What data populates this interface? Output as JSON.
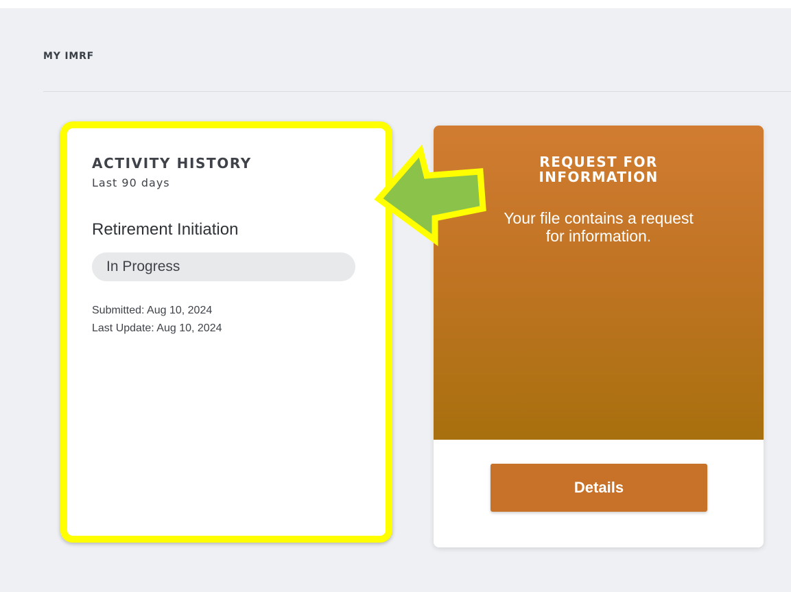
{
  "section": {
    "title": "MY IMRF"
  },
  "activity": {
    "title": "ACTIVITY HISTORY",
    "subtitle": "Last 90 days",
    "item_name": "Retirement Initiation",
    "status": "In Progress",
    "submitted": "Submitted: Aug 10, 2024",
    "last_update": "Last Update: Aug 10, 2024"
  },
  "request": {
    "title_line1": "REQUEST FOR",
    "title_line2": "INFORMATION",
    "text_line1": "Your file contains a request",
    "text_line2": "for information.",
    "button_label": "Details"
  },
  "colors": {
    "highlight": "#ffff00",
    "arrow_fill": "#8bc34a",
    "card_orange": "#c17424",
    "button_orange": "#c77129"
  },
  "icons": {
    "annotation": "arrow-left-icon"
  }
}
